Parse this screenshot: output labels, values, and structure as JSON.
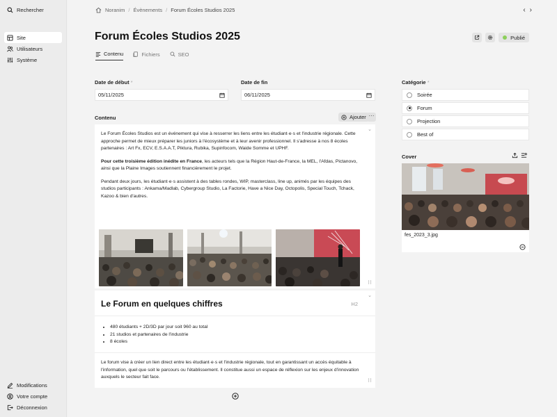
{
  "sidebar": {
    "search": "Rechercher",
    "items": [
      {
        "label": "Site",
        "icon": "layout-icon",
        "active": true
      },
      {
        "label": "Utilisateurs",
        "icon": "users-icon"
      },
      {
        "label": "Système",
        "icon": "sliders-icon"
      }
    ],
    "bottom": [
      {
        "label": "Modifications",
        "icon": "pencil-icon"
      },
      {
        "label": "Votre compte",
        "icon": "user-circle-icon"
      },
      {
        "label": "Déconnexion",
        "icon": "logout-icon"
      }
    ]
  },
  "breadcrumb": [
    "Noranim",
    "Évènements",
    "Forum Écoles Studios 2025"
  ],
  "page": {
    "title": "Forum Écoles Studios 2025",
    "status": "Publié",
    "status_color": "#8ccf5b"
  },
  "tabs": [
    {
      "label": "Contenu",
      "active": true
    },
    {
      "label": "Fichiers"
    },
    {
      "label": "SEO"
    }
  ],
  "dates": {
    "start_label": "Date de début",
    "start_value": "05/11/2025",
    "end_label": "Date de fin",
    "end_value": "06/11/2025"
  },
  "content": {
    "label": "Contenu",
    "add_label": "Ajouter",
    "more_label": "···",
    "p1": "Le Forum Écoles Studios est un événement qui vise à resserrer les liens entre les étudiant·e·s et l'industrie régionale. Cette approche permet de mieux préparer les juniors à l'écosystème et à leur avenir professionnel. Il s'adresse à nos 8 écoles partenaires : Art Fx, ECV, E.S.A.A.T, Piktura, Rubika, Supinfocom, Waide Somme et UPHF.",
    "p2_bold": "Pour cette troisième édition inédite en France",
    "p2_rest": ", les acteurs tels que la Région Haut-de-France, la MEL, l'Afdas, Pictanovo, ainsi que la Plaine Images soutiennent financièrement le projet.",
    "p3": "Pendant deux jours, les étudiant·e·s assistent à des tables rondes, WIP, masterclass, line up, animés par les équipes des studios participants : Ankama/Madlab, Cybergroup Studio, La Factorie, Have a Nice Day, Octopolis, Special Touch, Tchack, Kazoo & bien d'autres.",
    "h2_title": "Le Forum en quelques chiffres",
    "h2_tag": "H2",
    "bullets": [
      "480 étudiants + 2D/3D par jour soit 960 au total",
      "21 studios et partenaires de l'industrie",
      "8 écoles"
    ],
    "p4": "Le forum vise à créer un lien direct entre les étudiant·e·s et l'industrie régionale, tout en garantissant un accès équitable à l'information, quel que soit le parcours ou l'établissement. Il constitue aussi un espace de réflexion sur les enjeux d'innovation auxquels le secteur fait face."
  },
  "category": {
    "label": "Catégorie",
    "required_mark": "*",
    "options": [
      {
        "label": "Soirée",
        "selected": false
      },
      {
        "label": "Forum",
        "selected": true
      },
      {
        "label": "Projection",
        "selected": false
      },
      {
        "label": "Best of",
        "selected": false
      }
    ]
  },
  "cover": {
    "label": "Cover",
    "filename": "fes_2023_3.jpg"
  }
}
